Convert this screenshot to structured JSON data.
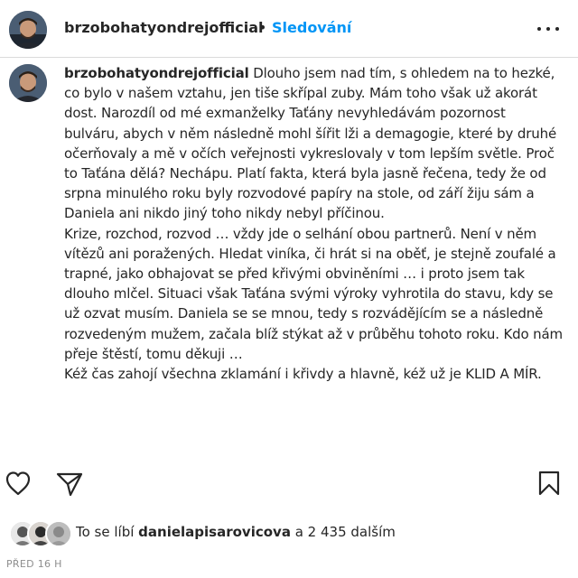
{
  "header": {
    "username": "brzobohatyondrejofficial",
    "separator": "•",
    "follow_label": "Sledování",
    "more_icon": "more-horizontal-icon"
  },
  "caption": {
    "username": "brzobohatyondrejofficial",
    "paragraph1": "Dlouho jsem nad tím, s ohledem na to hezké, co bylo v našem vztahu, jen tiše skřípal zuby. Mám toho však už akorát dost. Narozdíl od mé exmanželky Taťány nevyhledávám pozornost bulváru, abych v něm následně mohl šířit lži a demagogie, které by druhé očerňovaly a mě v očích veřejnosti vykreslovaly v tom lepším světle. Proč to Taťána dělá? Nechápu. Platí fakta, která byla jasně řečena, tedy že od srpna minulého roku byly rozvodové papíry na stole, od září žiju sám a Daniela ani nikdo jiný toho nikdy nebyl příčinou.",
    "paragraph2": "Krize, rozchod, rozvod … vždy jde o selhání obou partnerů. Není v něm vítězů ani poražených. Hledat viníka, či hrát si na oběť, je stejně zoufalé a trapné, jako obhajovat se před křivými obviněními … i proto jsem tak dlouho mlčel. Situaci však Taťána svými výroky vyhrotila do stavu, kdy se už ozvat musím. Daniela se se mnou, tedy s rozvádějícím se a následně rozvedeným mužem, začala blíž stýkat až v průběhu tohoto roku. Kdo nám přeje štěstí, tomu děkuji …",
    "paragraph3": "Kéž čas zahojí všechna zklamání i křivdy a hlavně, kéž už je KLID A MÍR."
  },
  "actions": {
    "like_icon": "heart-icon",
    "share_icon": "send-icon",
    "save_icon": "bookmark-icon"
  },
  "likes": {
    "prefix": "To se líbí ",
    "user": "danielapisarovicova",
    "suffix": " a 2 435 dalším"
  },
  "timestamp": "PŘED 16 H"
}
